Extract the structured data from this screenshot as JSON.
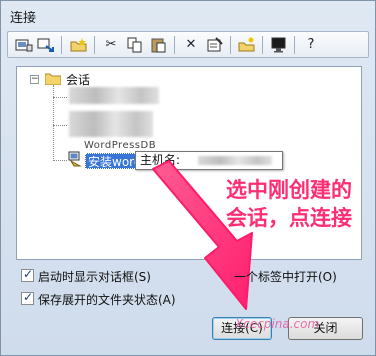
{
  "window": {
    "title": "连接"
  },
  "toolbar": {
    "buttons": [
      "new-session",
      "connect",
      "new-folder",
      "cut",
      "copy",
      "paste",
      "delete",
      "properties",
      "new-shortcut",
      "desktop",
      "help"
    ]
  },
  "tree": {
    "root_label": "会话",
    "partially_visible_label": "WordPressDB",
    "selected_session_label": "安装word",
    "tooltip_label": "主机名:"
  },
  "annotation": {
    "line1": "选中刚创建的",
    "line2": "会话，点连接"
  },
  "options": {
    "show_on_startup": {
      "label": "启动时显示对话框(S)",
      "checked": true
    },
    "open_in_tab": {
      "label": "一个标签中打开(O)",
      "checked": false
    },
    "save_folder_state": {
      "label": "保存展开的文件夹状态(A)",
      "checked": true
    }
  },
  "buttons": {
    "connect": "连接(C)",
    "close": "关闭"
  },
  "watermark": "Xcecpina.com",
  "colors": {
    "annotation": "#ff2d73",
    "selection": "#3875d7"
  }
}
